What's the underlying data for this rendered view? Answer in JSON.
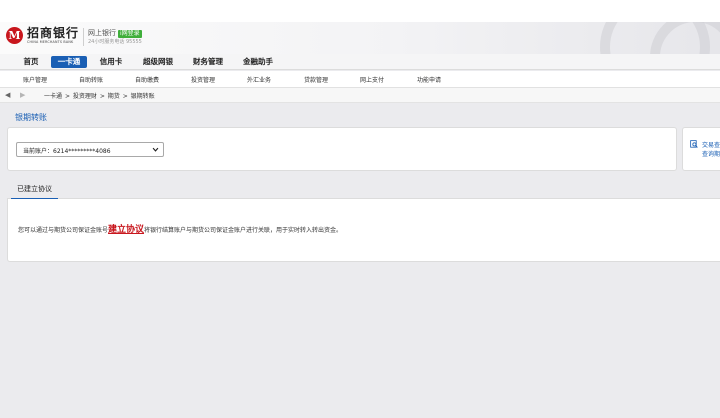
{
  "brand": {
    "name": "招商银行",
    "english": "CHINA MERCHANTS BANK",
    "netbank_label": "网上银行",
    "login_badge": "i网登录",
    "hotline": "24小时服务电话 95555",
    "color": "#c8161d"
  },
  "main_nav": [
    {
      "label": "首页"
    },
    {
      "label": "一卡通",
      "active": true
    },
    {
      "label": "信用卡"
    },
    {
      "label": "超级网银"
    },
    {
      "label": "财务管理"
    },
    {
      "label": "金融助手"
    }
  ],
  "sub_nav": [
    "账户管理",
    "自助转账",
    "自助缴费",
    "投资管理",
    "外汇业务",
    "贷款管理",
    "网上支付",
    "功能申请"
  ],
  "breadcrumb": {
    "items": [
      "一卡通",
      ">",
      "投资理财",
      ">",
      "期货",
      ">",
      "银期转账"
    ],
    "back_icon": "arrow-left-icon",
    "forward_icon": "arrow-right-icon"
  },
  "page": {
    "title": "银期转账",
    "account_select": {
      "value": "当前账户：6214*********4086"
    },
    "side_card": {
      "line1": "交易查",
      "line2": "查询期"
    },
    "tab_label": "已建立协议",
    "description_prefix": "您可以通过与期货公司保证金账号",
    "description_link": "建立协议",
    "description_suffix": "将银行结算账户与期货公司保证金账户进行关联，用于实时转入转出资金。"
  },
  "colors": {
    "accent": "#1a5fb4",
    "link_red": "#c8161d",
    "background": "#ebebee"
  }
}
